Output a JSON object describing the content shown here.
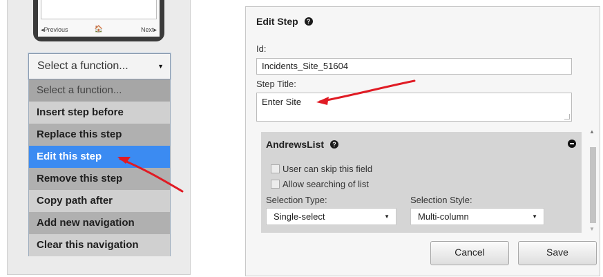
{
  "phone_nav": {
    "previous": "◂Previous",
    "home": "🏠",
    "next": "Next▸"
  },
  "function_select": {
    "value": "Select a function...",
    "options": [
      "Select a function...",
      "Insert step before",
      "Replace this step",
      "Edit this step",
      "Remove this step",
      "Copy path after",
      "Add new navigation",
      "Clear this navigation"
    ]
  },
  "edit_step": {
    "title": "Edit Step",
    "id_label": "Id:",
    "id_value": "Incidents_Site_51604",
    "step_title_label": "Step Title:",
    "step_title_value": "Enter Site",
    "field": {
      "name": "AndrewsList",
      "skip_label": "User can skip this field",
      "search_label": "Allow searching of list",
      "selection_type_label": "Selection Type:",
      "selection_type_value": "Single-select",
      "selection_style_label": "Selection Style:",
      "selection_style_value": "Multi-column"
    },
    "cancel_label": "Cancel",
    "save_label": "Save"
  },
  "colors": {
    "selected": "#3b8bf2",
    "arrow": "#e01b24"
  }
}
